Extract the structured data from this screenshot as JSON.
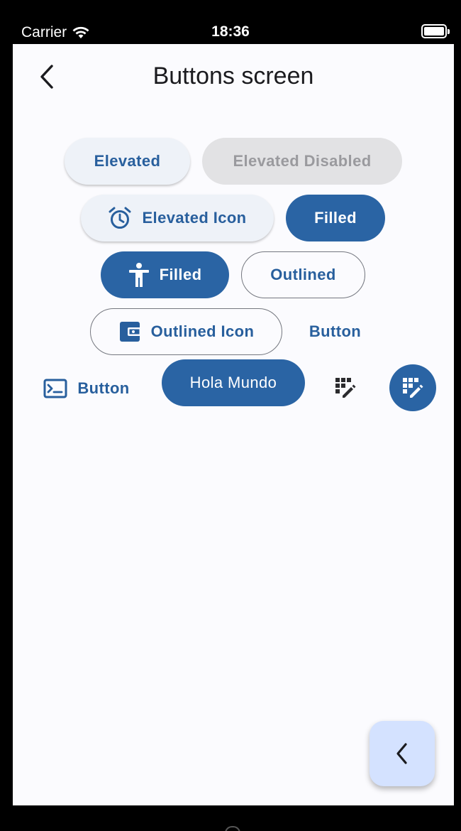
{
  "status_bar": {
    "carrier": "Carrier",
    "time": "18:36"
  },
  "app_bar": {
    "title": "Buttons screen"
  },
  "buttons": {
    "elevated": "Elevated",
    "elevated_disabled": "Elevated Disabled",
    "elevated_icon": "Elevated Icon",
    "filled": "Filled",
    "filled_icon": "Filled",
    "outlined": "Outlined",
    "outlined_icon": "Outlined Icon",
    "text": "Button",
    "text_icon": "Button",
    "custom": "Hola Mundo"
  },
  "icons": {
    "elevated_icon": "alarm-icon",
    "filled_icon": "accessibility-icon",
    "outlined_icon": "wallet-icon",
    "text_icon": "terminal-icon",
    "icon_button": "grid-edit-icon",
    "filled_icon_button": "grid-edit-icon",
    "fab": "chevron-left-icon"
  },
  "colors": {
    "primary": "#2a64a4",
    "on_primary": "#ffffff",
    "background": "#fbfbfe",
    "fab_container": "#d4e2ff",
    "disabled_container": "#e2e2e4"
  }
}
